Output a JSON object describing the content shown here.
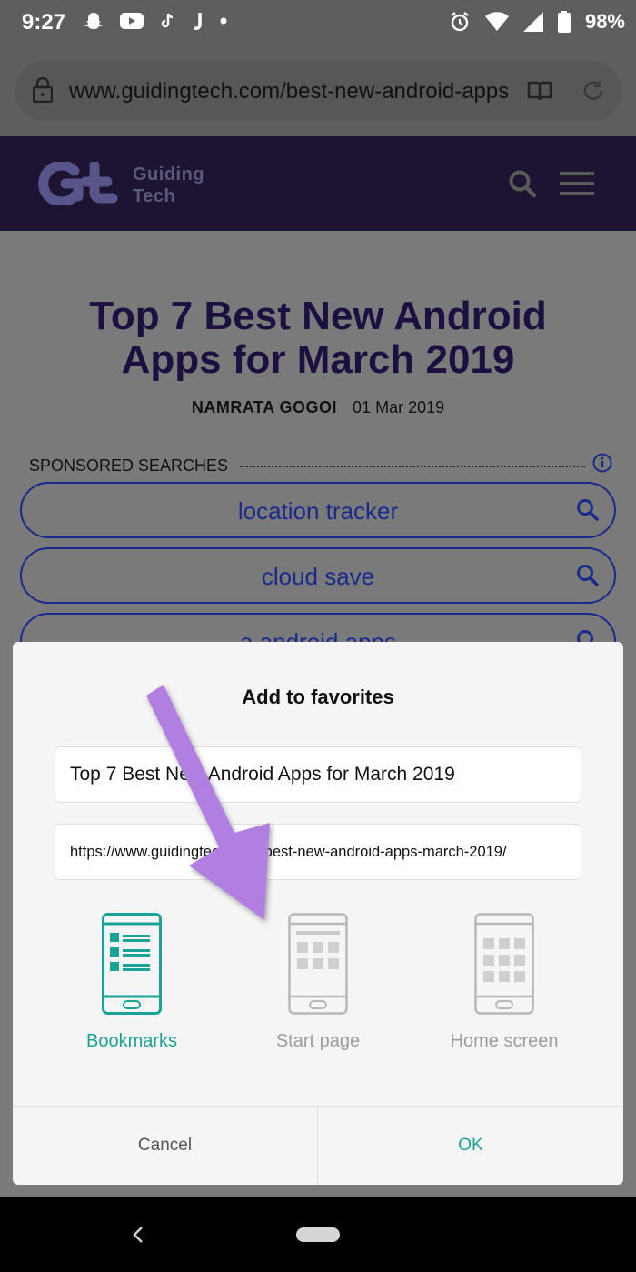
{
  "status_bar": {
    "time": "9:27",
    "battery": "98%"
  },
  "browser": {
    "url": "www.guidingtech.com/best-new-android-apps"
  },
  "site": {
    "logo_line1": "Guiding",
    "logo_line2": "Tech"
  },
  "article": {
    "title": "Top 7 Best New Android Apps for March 2019",
    "author": "NAMRATA GOGOI",
    "date": "01 Mar 2019"
  },
  "sponsored": {
    "heading": "SPONSORED SEARCHES",
    "items": [
      "location tracker",
      "cloud save",
      "a android apps"
    ]
  },
  "dialog": {
    "title": "Add to favorites",
    "name_value": "Top 7 Best New Android Apps for March 2019",
    "url_value": "https://www.guidingtech.com/best-new-android-apps-march-2019/",
    "options": [
      "Bookmarks",
      "Start page",
      "Home screen"
    ],
    "cancel": "Cancel",
    "ok": "OK"
  },
  "colors": {
    "accent": "#1aa394",
    "arrow": "#b07fe0",
    "site_header": "#1c1430"
  }
}
